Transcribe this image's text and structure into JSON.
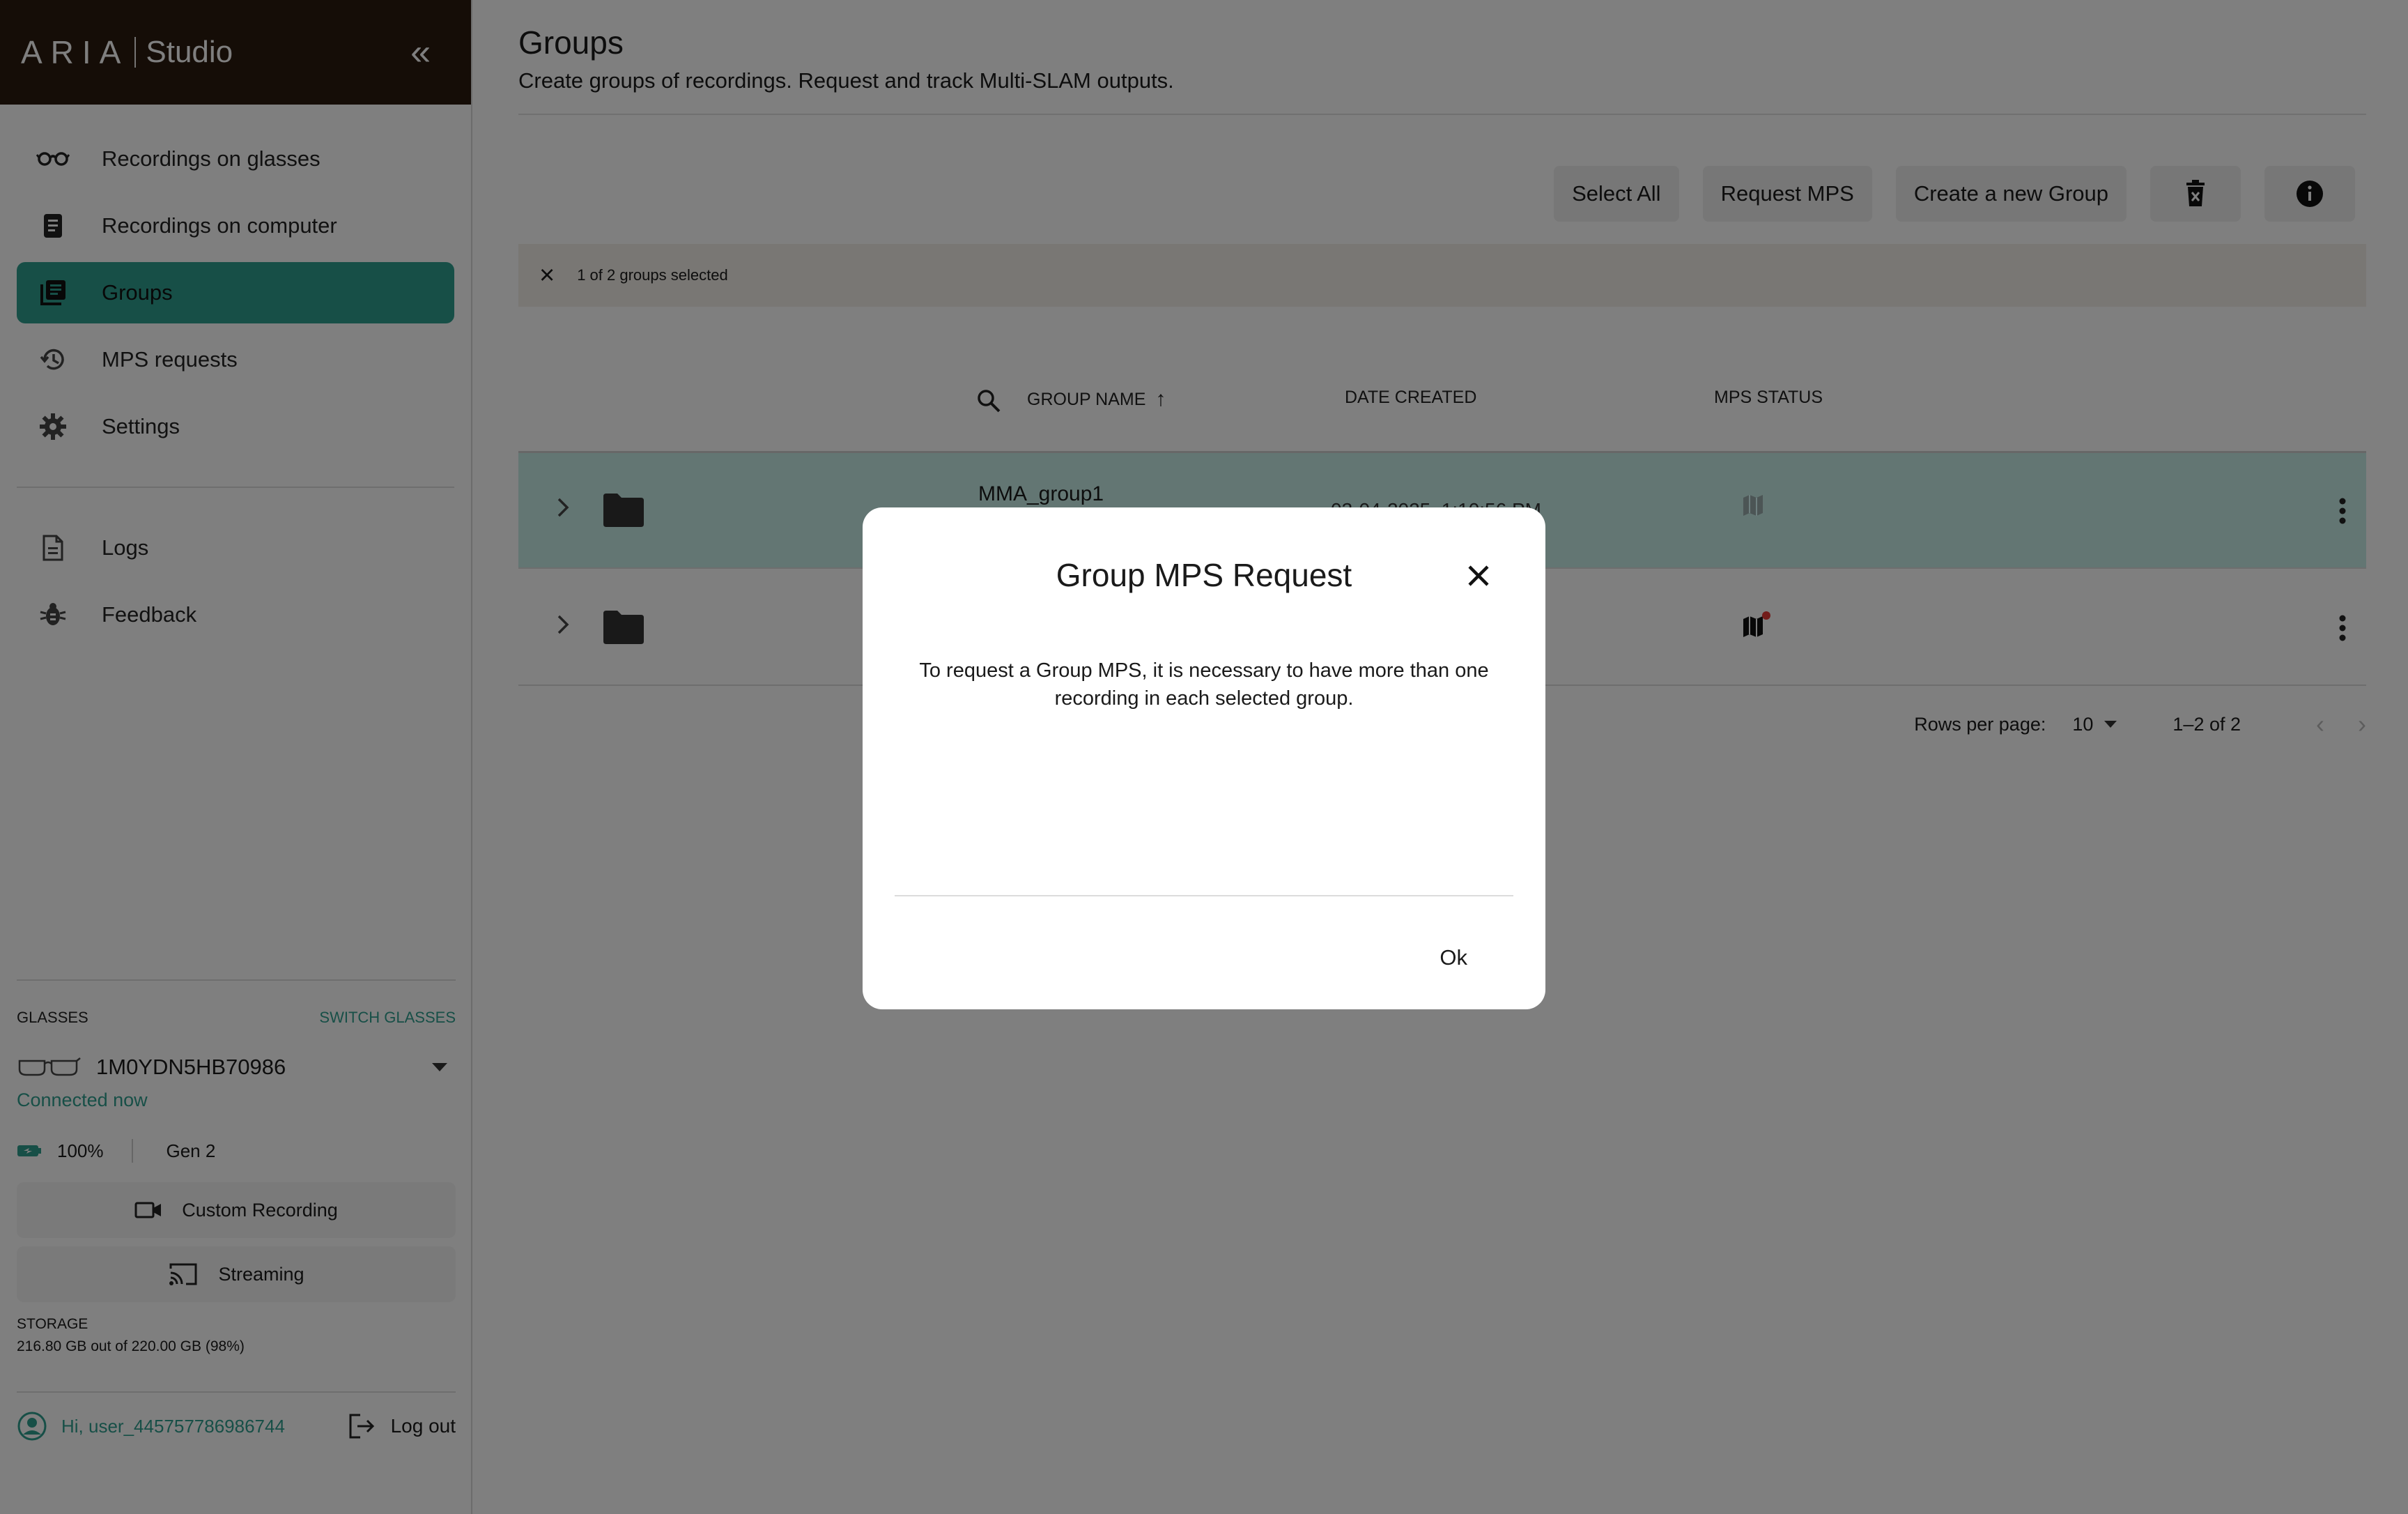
{
  "brand": {
    "name": "ARIA",
    "product": "Studio"
  },
  "sidebar": {
    "items": [
      {
        "label": "Recordings on glasses"
      },
      {
        "label": "Recordings on computer"
      },
      {
        "label": "Groups"
      },
      {
        "label": "MPS requests"
      },
      {
        "label": "Settings"
      }
    ],
    "secondary": [
      {
        "label": "Logs"
      },
      {
        "label": "Feedback"
      }
    ],
    "active_item": "Groups",
    "glasses": {
      "section_title": "GLASSES",
      "switch_label": "SWITCH GLASSES",
      "device_name": "1M0YDN5HB70986",
      "connection": "Connected now",
      "battery": "100%",
      "generation": "Gen 2",
      "custom_recording_label": "Custom Recording",
      "streaming_label": "Streaming"
    },
    "storage": {
      "title": "STORAGE",
      "text": "216.80 GB out of 220.00 GB (98%)"
    },
    "user": {
      "greeting": "Hi, user_445757786986744",
      "logout_label": "Log out"
    }
  },
  "main": {
    "title": "Groups",
    "subtitle": "Create groups of recordings. Request and track Multi-SLAM outputs.",
    "toolbar": {
      "select_all": "Select All",
      "request_mps": "Request MPS",
      "create_group": "Create a new Group"
    },
    "selection": "1 of 2 groups selected",
    "table": {
      "columns": {
        "name": "GROUP NAME",
        "date": "DATE CREATED",
        "status": "MPS STATUS"
      },
      "rows": [
        {
          "name": "MMA_group1",
          "date": "03-04-2025, 1:10:56 PM"
        },
        {
          "name": "",
          "date": ""
        }
      ]
    },
    "pagination": {
      "rows_per_page_label": "Rows per page:",
      "rows_per_page": "10",
      "range": "1–2 of 2"
    }
  },
  "dialog": {
    "title": "Group MPS Request",
    "body": "To request a Group MPS, it is necessary to have more than one recording in each selected group.",
    "ok_label": "Ok"
  },
  "colors": {
    "brand_bar": "#2a1a0e",
    "accent": "#2f9f8e",
    "selected_row": "#c6ece6",
    "status_dot": "#e53935"
  }
}
